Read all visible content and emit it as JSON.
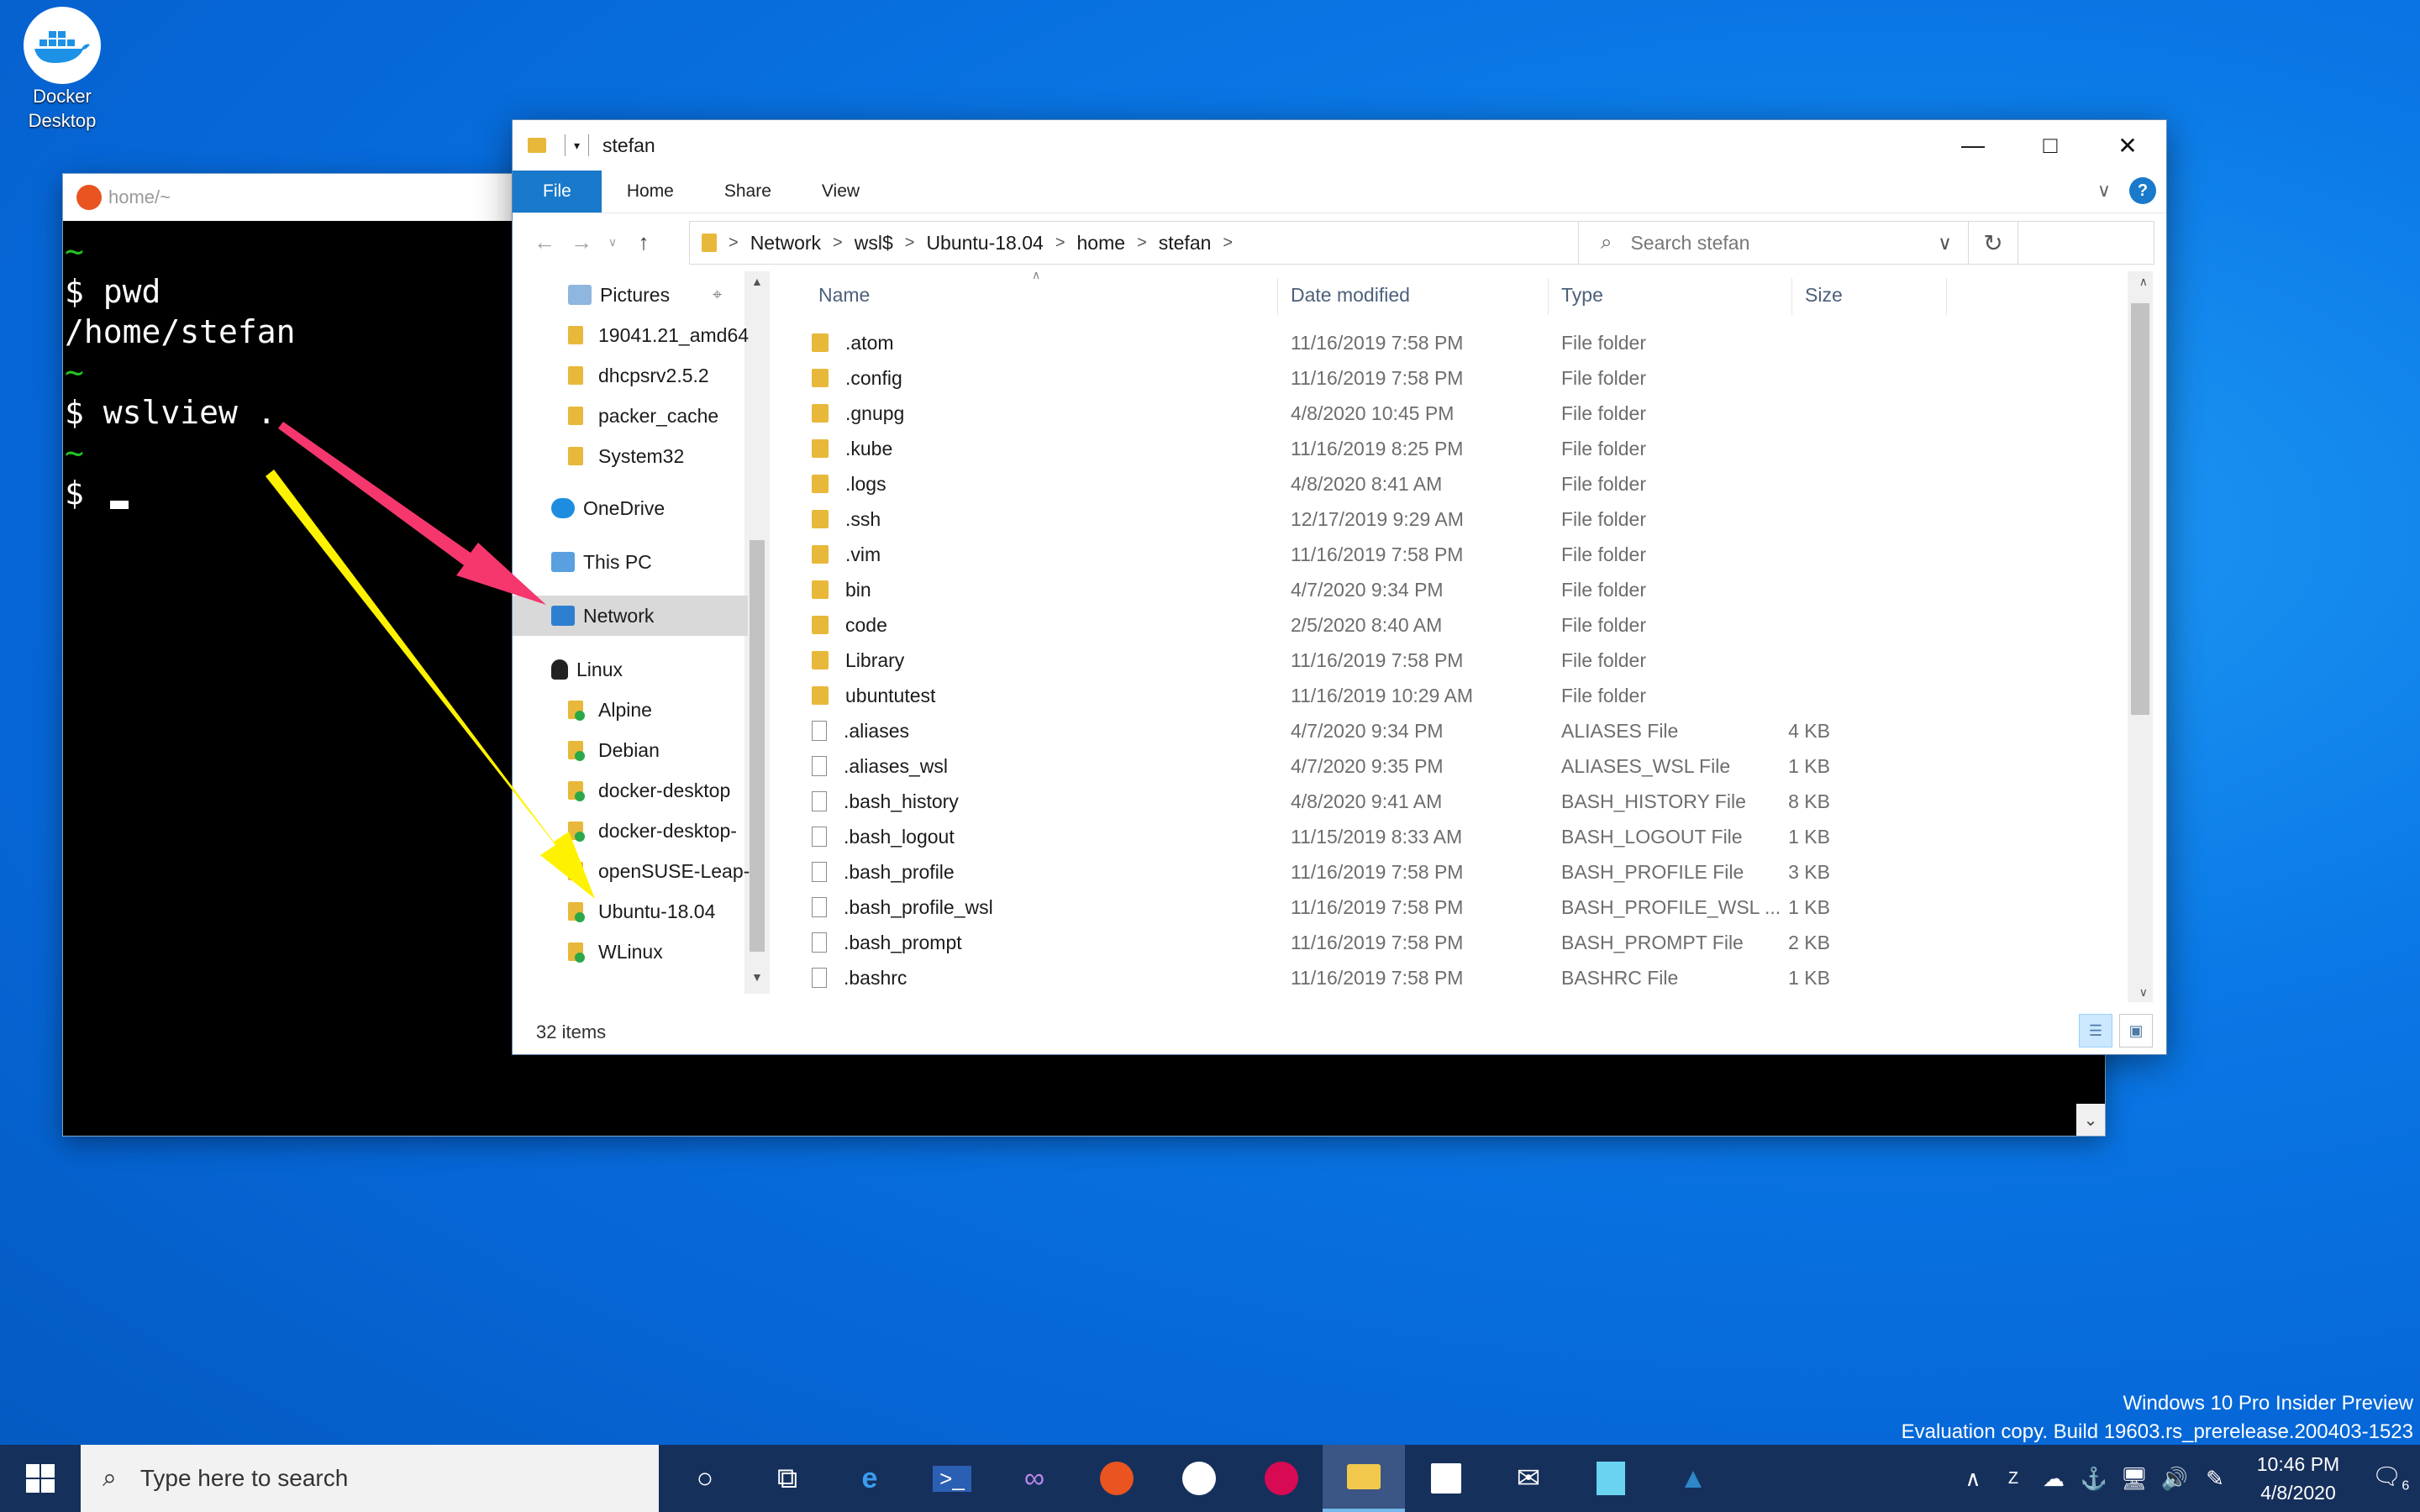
{
  "desktop": {
    "icon_label_line1": "Docker",
    "icon_label_line2": "Desktop"
  },
  "terminal": {
    "title": "home/~",
    "lines": [
      {
        "text": "~",
        "kind": "tilde"
      },
      {
        "text": "$ pwd",
        "kind": "cmd"
      },
      {
        "text": "/home/stefan",
        "kind": "out"
      },
      {
        "text": "~",
        "kind": "tilde"
      },
      {
        "text": "$ wslview .",
        "kind": "cmd"
      },
      {
        "text": "~",
        "kind": "tilde"
      },
      {
        "text": "$ ",
        "kind": "prompt"
      }
    ]
  },
  "explorer": {
    "title": "stefan",
    "ribbon_tabs": [
      "File",
      "Home",
      "Share",
      "View"
    ],
    "address": [
      "Network",
      "wsl$",
      "Ubuntu-18.04",
      "home",
      "stefan"
    ],
    "search_placeholder": "Search stefan",
    "nav_items": [
      {
        "label": "Pictures",
        "icon": "pictures-icon",
        "indent": 1,
        "pinned": true
      },
      {
        "label": "19041.21_amd64",
        "icon": "folder-icon",
        "indent": 1
      },
      {
        "label": "dhcpsrv2.5.2",
        "icon": "folder-icon",
        "indent": 1
      },
      {
        "label": "packer_cache",
        "icon": "folder-icon",
        "indent": 1
      },
      {
        "label": "System32",
        "icon": "folder-icon",
        "indent": 1
      },
      {
        "label": "OneDrive",
        "icon": "onedrive-icon",
        "indent": 0
      },
      {
        "label": "This PC",
        "icon": "this-pc-icon",
        "indent": 0
      },
      {
        "label": "Network",
        "icon": "network-icon",
        "indent": 0,
        "selected": true
      },
      {
        "label": "Linux",
        "icon": "tux-icon",
        "indent": 0
      },
      {
        "label": "Alpine",
        "icon": "linux-folder-icon",
        "indent": 1
      },
      {
        "label": "Debian",
        "icon": "linux-folder-icon",
        "indent": 1
      },
      {
        "label": "docker-desktop",
        "icon": "linux-folder-icon",
        "indent": 1
      },
      {
        "label": "docker-desktop-",
        "icon": "linux-folder-icon",
        "indent": 1
      },
      {
        "label": "openSUSE-Leap-",
        "icon": "linux-folder-icon",
        "indent": 1
      },
      {
        "label": "Ubuntu-18.04",
        "icon": "linux-folder-icon",
        "indent": 1
      },
      {
        "label": "WLinux",
        "icon": "linux-folder-icon",
        "indent": 1
      }
    ],
    "columns": {
      "name": "Name",
      "date": "Date modified",
      "type": "Type",
      "size": "Size"
    },
    "files": [
      {
        "name": ".atom",
        "date": "11/16/2019 7:58 PM",
        "type": "File folder",
        "size": "",
        "folder": true
      },
      {
        "name": ".config",
        "date": "11/16/2019 7:58 PM",
        "type": "File folder",
        "size": "",
        "folder": true
      },
      {
        "name": ".gnupg",
        "date": "4/8/2020 10:45 PM",
        "type": "File folder",
        "size": "",
        "folder": true
      },
      {
        "name": ".kube",
        "date": "11/16/2019 8:25 PM",
        "type": "File folder",
        "size": "",
        "folder": true
      },
      {
        "name": ".logs",
        "date": "4/8/2020 8:41 AM",
        "type": "File folder",
        "size": "",
        "folder": true
      },
      {
        "name": ".ssh",
        "date": "12/17/2019 9:29 AM",
        "type": "File folder",
        "size": "",
        "folder": true
      },
      {
        "name": ".vim",
        "date": "11/16/2019 7:58 PM",
        "type": "File folder",
        "size": "",
        "folder": true
      },
      {
        "name": "bin",
        "date": "4/7/2020 9:34 PM",
        "type": "File folder",
        "size": "",
        "folder": true
      },
      {
        "name": "code",
        "date": "2/5/2020 8:40 AM",
        "type": "File folder",
        "size": "",
        "folder": true
      },
      {
        "name": "Library",
        "date": "11/16/2019 7:58 PM",
        "type": "File folder",
        "size": "",
        "folder": true
      },
      {
        "name": "ubuntutest",
        "date": "11/16/2019 10:29 AM",
        "type": "File folder",
        "size": "",
        "folder": true
      },
      {
        "name": ".aliases",
        "date": "4/7/2020 9:34 PM",
        "type": "ALIASES File",
        "size": "4 KB",
        "folder": false
      },
      {
        "name": ".aliases_wsl",
        "date": "4/7/2020 9:35 PM",
        "type": "ALIASES_WSL File",
        "size": "1 KB",
        "folder": false
      },
      {
        "name": ".bash_history",
        "date": "4/8/2020 9:41 AM",
        "type": "BASH_HISTORY File",
        "size": "8 KB",
        "folder": false
      },
      {
        "name": ".bash_logout",
        "date": "11/15/2019 8:33 AM",
        "type": "BASH_LOGOUT File",
        "size": "1 KB",
        "folder": false
      },
      {
        "name": ".bash_profile",
        "date": "11/16/2019 7:58 PM",
        "type": "BASH_PROFILE File",
        "size": "3 KB",
        "folder": false
      },
      {
        "name": ".bash_profile_wsl",
        "date": "11/16/2019 7:58 PM",
        "type": "BASH_PROFILE_WSL ...",
        "size": "1 KB",
        "folder": false
      },
      {
        "name": ".bash_prompt",
        "date": "11/16/2019 7:58 PM",
        "type": "BASH_PROMPT File",
        "size": "2 KB",
        "folder": false
      },
      {
        "name": ".bashrc",
        "date": "11/16/2019 7:58 PM",
        "type": "BASHRC File",
        "size": "1 KB",
        "folder": false
      }
    ],
    "status": "32 items"
  },
  "watermark": {
    "line1": "Windows 10 Pro Insider Preview",
    "line2": "Evaluation copy. Build 19603.rs_prerelease.200403-1523"
  },
  "taskbar": {
    "search_placeholder": "Type here to search",
    "clock_time": "10:46 PM",
    "clock_date": "4/8/2020",
    "notification_count": "6"
  },
  "colors": {
    "accent": "#1979ca",
    "arrow_pink": "#f5376d",
    "arrow_yellow": "#fff200",
    "terminal_green": "#23c423"
  }
}
